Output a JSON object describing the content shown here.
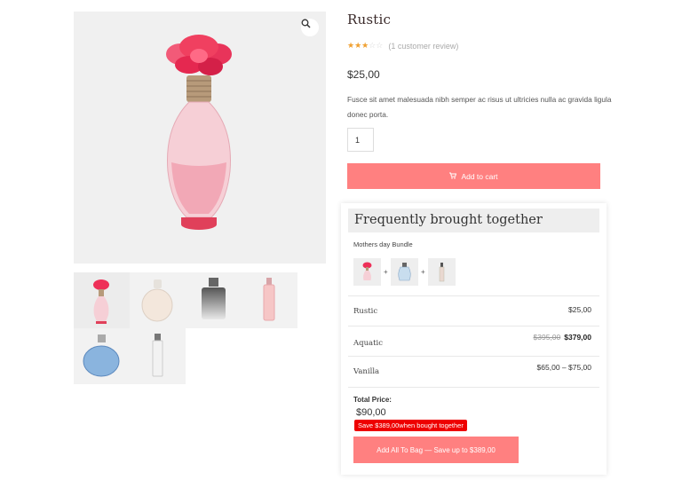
{
  "product": {
    "title": "Rustic",
    "rating": 3,
    "rating_max": 5,
    "review_text": "(1 customer review)",
    "price": "$25,00",
    "description": "Fusce sit amet malesuada nibh semper ac risus ut ultricies nulla ac gravida ligula donec porta.",
    "quantity": "1",
    "add_to_cart": "Add to cart",
    "zoom_icon": "search-icon",
    "cart_icon": "cart-icon"
  },
  "fbt": {
    "heading": "Frequently brought together",
    "bundle_name": "Mothers day Bundle",
    "items": [
      {
        "name": "Rustic",
        "old_price": "",
        "price": "$25,00"
      },
      {
        "name": "Aquatic",
        "old_price": "$395,00",
        "price": "$379,00"
      },
      {
        "name": "Vanilla",
        "old_price": "",
        "price": "$65,00 – $75,00"
      }
    ],
    "plus": "+",
    "total_label": "Total Price:",
    "total_value": "$90,00",
    "save_text": "Save $389,00when bought together",
    "add_all_label": "Add All To Bag — Save up to  $389,00"
  },
  "colors": {
    "accent": "#ff8080",
    "badge": "#ee0000",
    "star": "#f0a030"
  }
}
